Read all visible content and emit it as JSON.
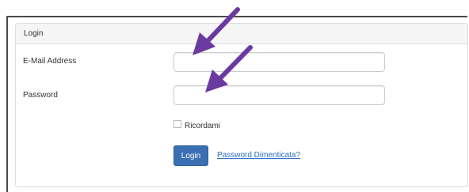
{
  "panel": {
    "heading": "Login"
  },
  "form": {
    "email_label": "E-Mail Address",
    "email_value": "",
    "password_label": "Password",
    "password_value": "",
    "remember_label": "Ricordami",
    "remember_checked": false,
    "login_button": "Login",
    "forgot_link": "Password Dimenticata?"
  },
  "annotations": {
    "arrow_color": "#6b3aa0",
    "arrow_icon": "arrow-annotation"
  },
  "colors": {
    "primary_button": "#3a6fb3",
    "link": "#2a6dc0",
    "panel_heading_bg": "#f5f5f5"
  }
}
